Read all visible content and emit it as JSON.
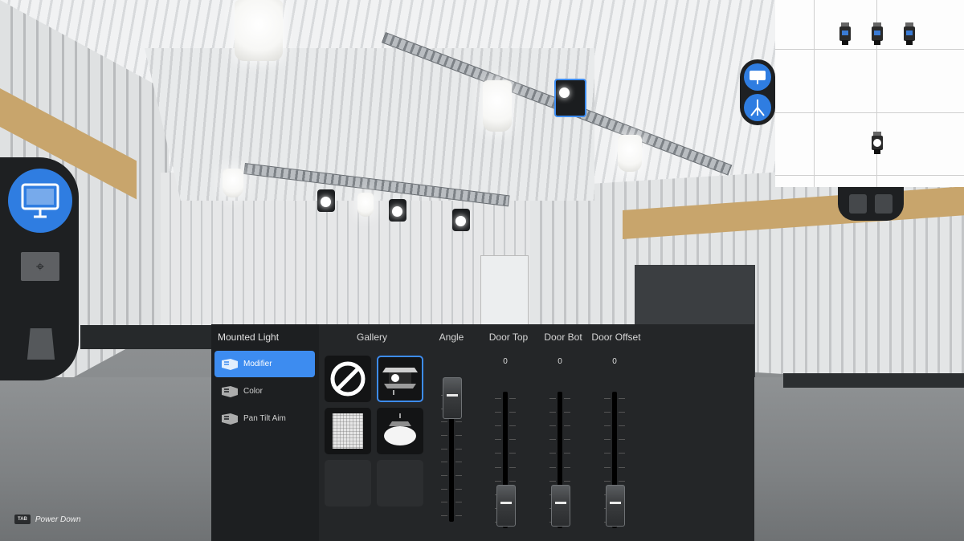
{
  "panel": {
    "title": "Mounted Light",
    "menu": [
      {
        "label": "Modifier",
        "active": true
      },
      {
        "label": "Color",
        "active": false
      },
      {
        "label": "Pan Tilt Aim",
        "active": false
      }
    ]
  },
  "gallery": {
    "label": "Gallery",
    "items": [
      {
        "name": "none",
        "selected": false
      },
      {
        "name": "barn-doors",
        "selected": true
      },
      {
        "name": "softbox-grid",
        "selected": false
      },
      {
        "name": "dome-diffuser",
        "selected": false
      },
      {
        "name": "empty",
        "selected": false
      },
      {
        "name": "empty",
        "selected": false
      }
    ]
  },
  "sliders": {
    "angle": {
      "label": "Angle",
      "value": 1.0
    },
    "door_top": {
      "label": "Door Top",
      "display": "0",
      "value": 0
    },
    "door_bot": {
      "label": "Door Bot",
      "display": "0",
      "value": 0
    },
    "door_offset": {
      "label": "Door Offset",
      "display": "0",
      "value": 0
    }
  },
  "hint": {
    "key": "TAB",
    "text": "Power Down"
  },
  "colors": {
    "accent": "#3d8cf0",
    "panel": "#1d1f21",
    "hud": "#1e2022"
  },
  "icons": {
    "left_hud": [
      "panel-light-icon",
      "layout-icon",
      "bag-icon"
    ],
    "minimap_switch": [
      "panel-light-icon",
      "tripod-icon"
    ]
  }
}
